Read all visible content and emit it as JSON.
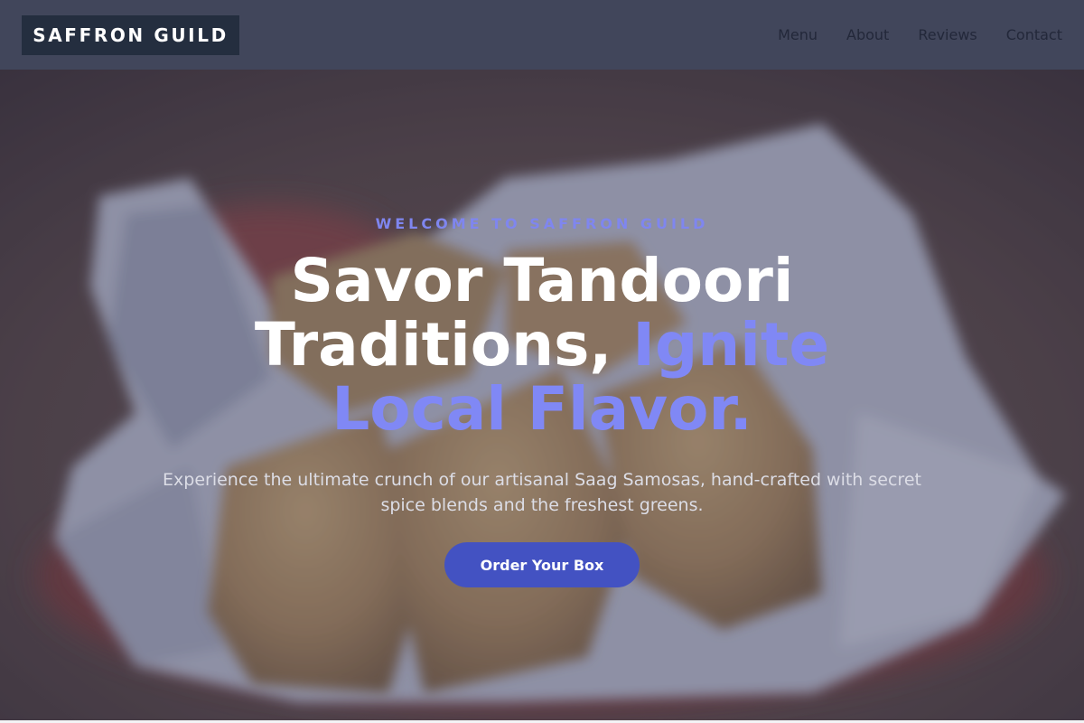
{
  "brand": {
    "name": "SAFFRON GUILD"
  },
  "nav": {
    "items": [
      {
        "label": "Menu"
      },
      {
        "label": "About"
      },
      {
        "label": "Reviews"
      },
      {
        "label": "Contact"
      }
    ]
  },
  "hero": {
    "eyebrow": "WELCOME TO SAFFRON GUILD",
    "headline_line1": "Savor Tandoori",
    "headline_line2": "Traditions,",
    "headline_accent": "Ignite Local Flavor.",
    "subtitle": "Experience the ultimate crunch of our artisanal Saag Samosas, hand-crafted with secret spice blends and the freshest greens.",
    "cta_label": "Order Your Box"
  },
  "colors": {
    "header_bg": "#41465b",
    "logo_bg": "#242e3f",
    "accent": "#8088f5",
    "cta_bg": "#4352c2"
  }
}
